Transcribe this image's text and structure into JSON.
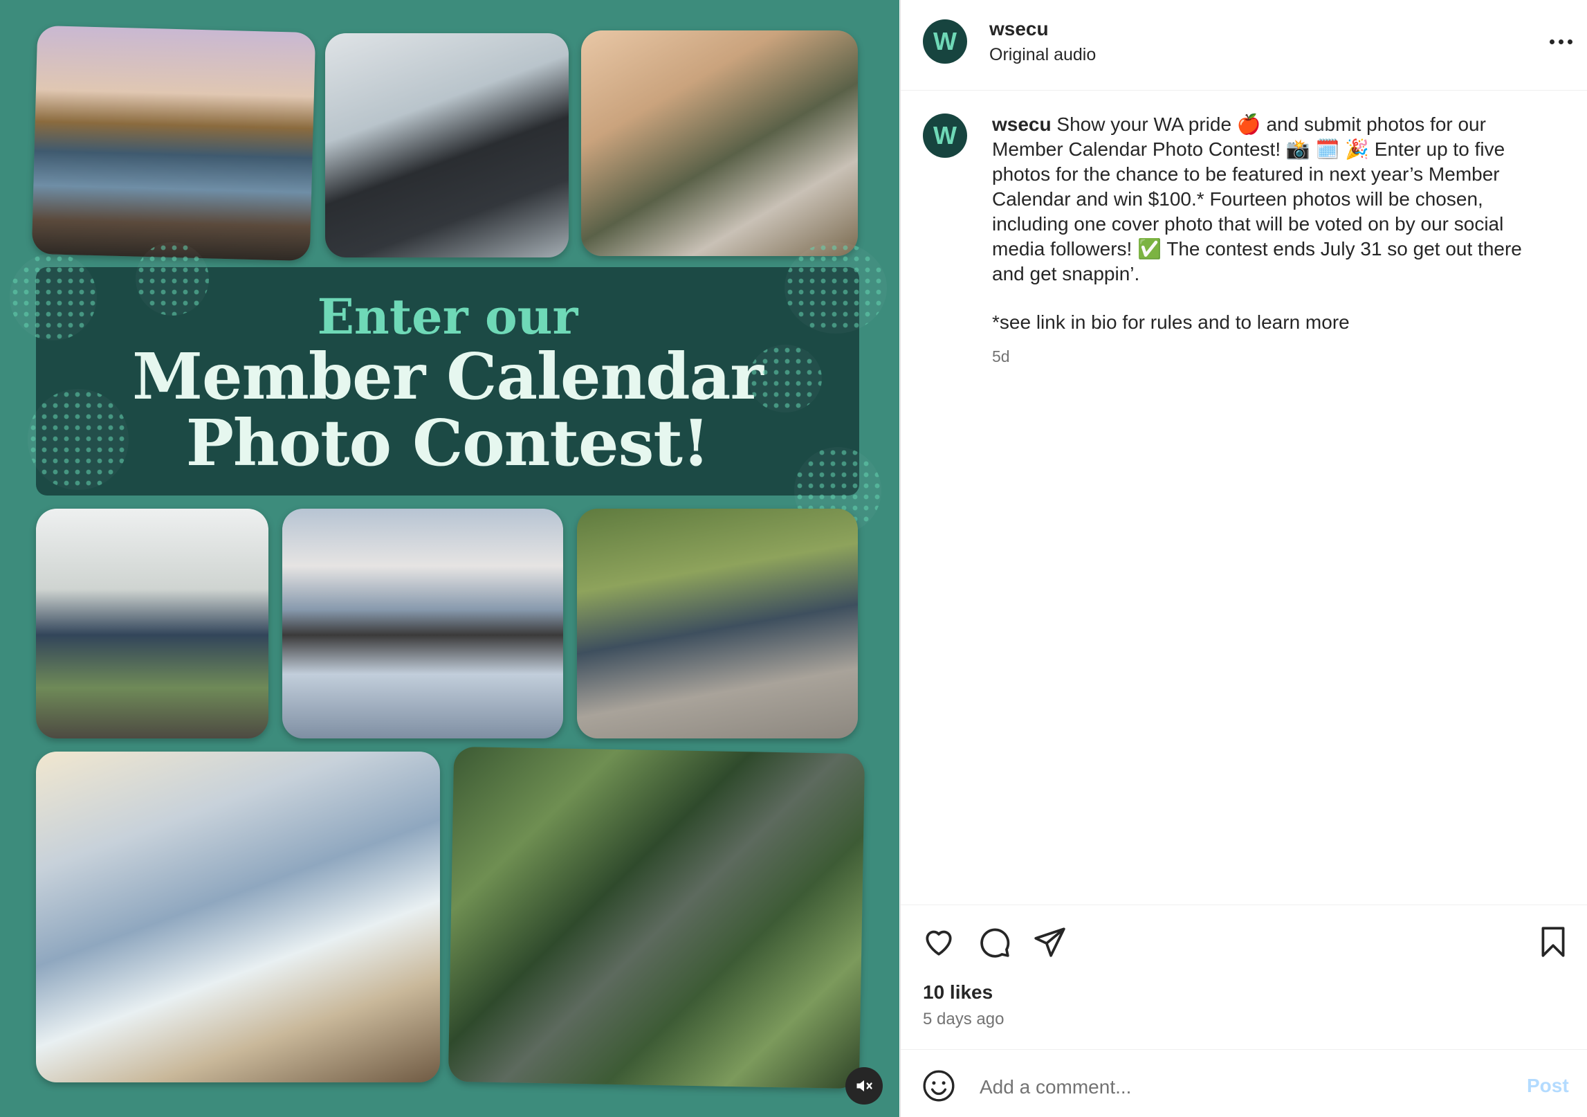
{
  "media": {
    "banner": {
      "line1": "Enter our",
      "line2": "Member Calendar",
      "line3": "Photo Contest!"
    },
    "colors": {
      "background": "#3d8c7c",
      "banner": "#1c4a45",
      "accent": "#6fd9b7"
    },
    "mute_icon": "speaker-muted-icon"
  },
  "header": {
    "avatar_letter": "W",
    "username": "wsecu",
    "subtitle": "Original audio",
    "more_icon": "more-options-icon"
  },
  "post": {
    "avatar_letter": "W",
    "username": "wsecu",
    "caption": "Show your WA pride 🍎 and submit photos for our Member Calendar Photo Contest! 📸 🗓️ 🎉 Enter up to five photos for the chance to be featured in next year’s Member Calendar and win $100.* Fourteen photos will be chosen, including one cover photo that will be voted on by our social media followers! ✅ The contest ends July 31 so get out there and get snappin’.",
    "footnote": "*see link in bio for rules and to learn more",
    "time": "5d"
  },
  "actions": {
    "like_icon": "heart-icon",
    "comment_icon": "comment-icon",
    "share_icon": "send-icon",
    "save_icon": "bookmark-icon"
  },
  "stats": {
    "likes": "10 likes",
    "time": "5 days ago"
  },
  "comment": {
    "emoji_icon": "emoji-icon",
    "placeholder": "Add a comment...",
    "post_label": "Post"
  }
}
